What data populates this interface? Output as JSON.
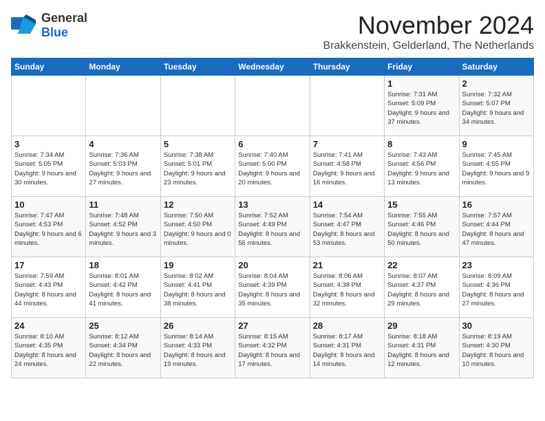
{
  "logo": {
    "general": "General",
    "blue": "Blue"
  },
  "title": "November 2024",
  "location": "Brakkenstein, Gelderland, The Netherlands",
  "header": {
    "days": [
      "Sunday",
      "Monday",
      "Tuesday",
      "Wednesday",
      "Thursday",
      "Friday",
      "Saturday"
    ]
  },
  "weeks": [
    [
      {
        "day": "",
        "info": ""
      },
      {
        "day": "",
        "info": ""
      },
      {
        "day": "",
        "info": ""
      },
      {
        "day": "",
        "info": ""
      },
      {
        "day": "",
        "info": ""
      },
      {
        "day": "1",
        "info": "Sunrise: 7:31 AM\nSunset: 5:09 PM\nDaylight: 9 hours and 37 minutes."
      },
      {
        "day": "2",
        "info": "Sunrise: 7:32 AM\nSunset: 5:07 PM\nDaylight: 9 hours and 34 minutes."
      }
    ],
    [
      {
        "day": "3",
        "info": "Sunrise: 7:34 AM\nSunset: 5:05 PM\nDaylight: 9 hours and 30 minutes."
      },
      {
        "day": "4",
        "info": "Sunrise: 7:36 AM\nSunset: 5:03 PM\nDaylight: 9 hours and 27 minutes."
      },
      {
        "day": "5",
        "info": "Sunrise: 7:38 AM\nSunset: 5:01 PM\nDaylight: 9 hours and 23 minutes."
      },
      {
        "day": "6",
        "info": "Sunrise: 7:40 AM\nSunset: 5:00 PM\nDaylight: 9 hours and 20 minutes."
      },
      {
        "day": "7",
        "info": "Sunrise: 7:41 AM\nSunset: 4:58 PM\nDaylight: 9 hours and 16 minutes."
      },
      {
        "day": "8",
        "info": "Sunrise: 7:43 AM\nSunset: 4:56 PM\nDaylight: 9 hours and 13 minutes."
      },
      {
        "day": "9",
        "info": "Sunrise: 7:45 AM\nSunset: 4:55 PM\nDaylight: 9 hours and 9 minutes."
      }
    ],
    [
      {
        "day": "10",
        "info": "Sunrise: 7:47 AM\nSunset: 4:53 PM\nDaylight: 9 hours and 6 minutes."
      },
      {
        "day": "11",
        "info": "Sunrise: 7:48 AM\nSunset: 4:52 PM\nDaylight: 9 hours and 3 minutes."
      },
      {
        "day": "12",
        "info": "Sunrise: 7:50 AM\nSunset: 4:50 PM\nDaylight: 9 hours and 0 minutes."
      },
      {
        "day": "13",
        "info": "Sunrise: 7:52 AM\nSunset: 4:49 PM\nDaylight: 8 hours and 56 minutes."
      },
      {
        "day": "14",
        "info": "Sunrise: 7:54 AM\nSunset: 4:47 PM\nDaylight: 8 hours and 53 minutes."
      },
      {
        "day": "15",
        "info": "Sunrise: 7:55 AM\nSunset: 4:46 PM\nDaylight: 8 hours and 50 minutes."
      },
      {
        "day": "16",
        "info": "Sunrise: 7:57 AM\nSunset: 4:44 PM\nDaylight: 8 hours and 47 minutes."
      }
    ],
    [
      {
        "day": "17",
        "info": "Sunrise: 7:59 AM\nSunset: 4:43 PM\nDaylight: 8 hours and 44 minutes."
      },
      {
        "day": "18",
        "info": "Sunrise: 8:01 AM\nSunset: 4:42 PM\nDaylight: 8 hours and 41 minutes."
      },
      {
        "day": "19",
        "info": "Sunrise: 8:02 AM\nSunset: 4:41 PM\nDaylight: 8 hours and 38 minutes."
      },
      {
        "day": "20",
        "info": "Sunrise: 8:04 AM\nSunset: 4:39 PM\nDaylight: 8 hours and 35 minutes."
      },
      {
        "day": "21",
        "info": "Sunrise: 8:06 AM\nSunset: 4:38 PM\nDaylight: 8 hours and 32 minutes."
      },
      {
        "day": "22",
        "info": "Sunrise: 8:07 AM\nSunset: 4:37 PM\nDaylight: 8 hours and 29 minutes."
      },
      {
        "day": "23",
        "info": "Sunrise: 8:09 AM\nSunset: 4:36 PM\nDaylight: 8 hours and 27 minutes."
      }
    ],
    [
      {
        "day": "24",
        "info": "Sunrise: 8:10 AM\nSunset: 4:35 PM\nDaylight: 8 hours and 24 minutes."
      },
      {
        "day": "25",
        "info": "Sunrise: 8:12 AM\nSunset: 4:34 PM\nDaylight: 8 hours and 22 minutes."
      },
      {
        "day": "26",
        "info": "Sunrise: 8:14 AM\nSunset: 4:33 PM\nDaylight: 8 hours and 19 minutes."
      },
      {
        "day": "27",
        "info": "Sunrise: 8:15 AM\nSunset: 4:32 PM\nDaylight: 8 hours and 17 minutes."
      },
      {
        "day": "28",
        "info": "Sunrise: 8:17 AM\nSunset: 4:31 PM\nDaylight: 8 hours and 14 minutes."
      },
      {
        "day": "29",
        "info": "Sunrise: 8:18 AM\nSunset: 4:31 PM\nDaylight: 8 hours and 12 minutes."
      },
      {
        "day": "30",
        "info": "Sunrise: 8:19 AM\nSunset: 4:30 PM\nDaylight: 8 hours and 10 minutes."
      }
    ]
  ]
}
